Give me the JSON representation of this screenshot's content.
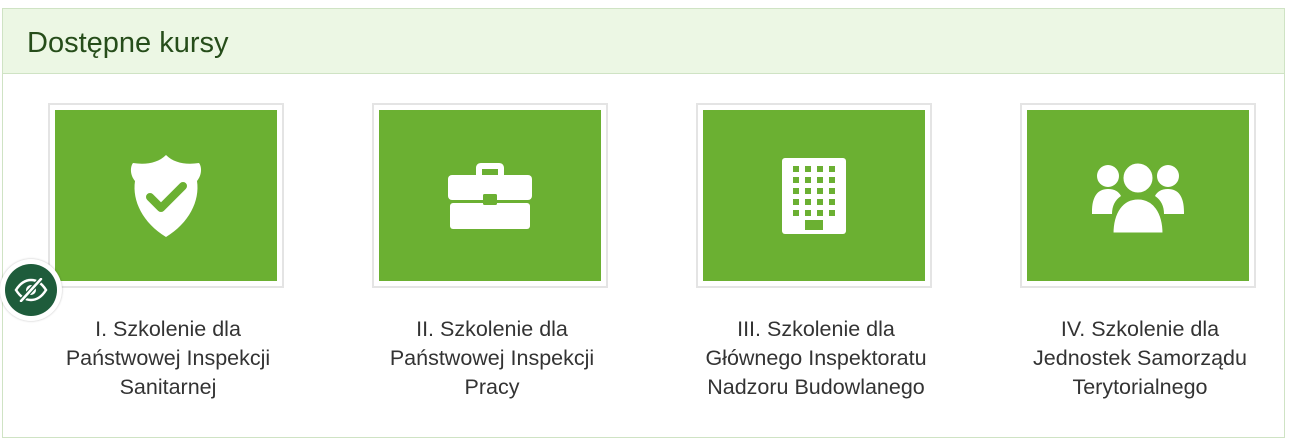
{
  "panel": {
    "title": "Dostępne kursy"
  },
  "courses": [
    {
      "icon": "shield-check-icon",
      "label_lines": [
        "I. Szkolenie dla",
        "Państwowej Inspekcji",
        "Sanitarnej"
      ]
    },
    {
      "icon": "briefcase-icon",
      "label_lines": [
        "II. Szkolenie dla",
        "Państwowej Inspekcji",
        "Pracy"
      ]
    },
    {
      "icon": "building-icon",
      "label_lines": [
        "III. Szkolenie dla",
        "Głównego Inspektoratu",
        "Nadzoru Budowlanego"
      ]
    },
    {
      "icon": "users-icon",
      "label_lines": [
        "IV. Szkolenie dla",
        "Jednostek Samorządu",
        "Terytorialnego"
      ]
    }
  ],
  "accessibility_toggle": {
    "icon": "eye-slash-icon"
  },
  "colors": {
    "tile_green": "#6bb032",
    "header_bg": "#ecf7e4",
    "header_text": "#264d1a",
    "badge_green": "#1e5c3b"
  }
}
